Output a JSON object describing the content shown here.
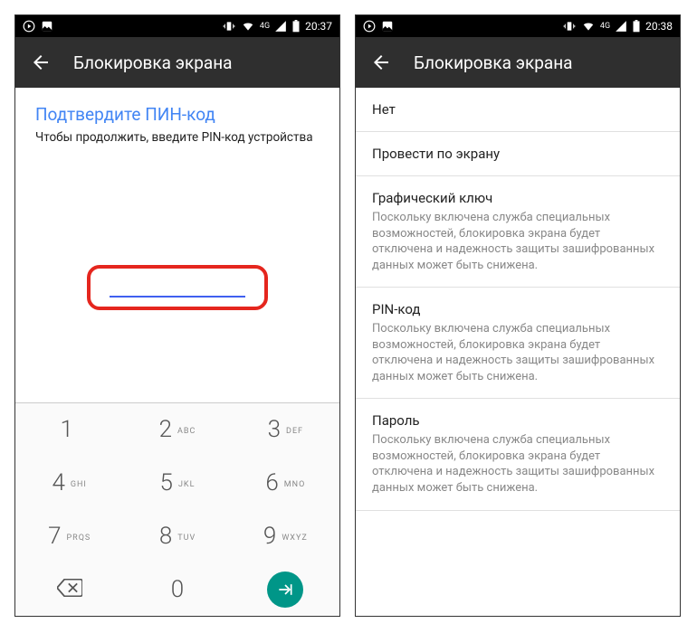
{
  "left": {
    "status": {
      "network": "4G",
      "time": "20:37"
    },
    "appbar": {
      "title": "Блокировка экрана"
    },
    "confirm": {
      "title": "Подтвердите ПИН-код",
      "subtitle": "Чтобы продолжить, введите PIN-код устройства"
    },
    "keypad": {
      "keys": [
        {
          "d": "1",
          "l": ""
        },
        {
          "d": "2",
          "l": "ABC"
        },
        {
          "d": "3",
          "l": "DEF"
        },
        {
          "d": "4",
          "l": "GHI"
        },
        {
          "d": "5",
          "l": "JKL"
        },
        {
          "d": "6",
          "l": "MNO"
        },
        {
          "d": "7",
          "l": "PRQS"
        },
        {
          "d": "8",
          "l": "TUV"
        },
        {
          "d": "9",
          "l": "WXYZ"
        },
        {
          "d": "",
          "l": ""
        },
        {
          "d": "0",
          "l": ""
        },
        {
          "d": "",
          "l": ""
        }
      ]
    }
  },
  "right": {
    "status": {
      "network": "4G",
      "time": "20:38"
    },
    "appbar": {
      "title": "Блокировка экрана"
    },
    "list": [
      {
        "title": "Нет",
        "sub": ""
      },
      {
        "title": "Провести по экрану",
        "sub": ""
      },
      {
        "title": "Графический ключ",
        "sub": "Поскольку включена служба специальных возможностей, блокировка экрана будет отключена и надежность защиты зашифрованных данных может быть снижена."
      },
      {
        "title": "PIN-код",
        "sub": "Поскольку включена служба специальных возможностей, блокировка экрана будет отключена и надежность защиты зашифрованных данных может быть снижена."
      },
      {
        "title": "Пароль",
        "sub": "Поскольку включена служба специальных возможностей, блокировка экрана будет отключена и надежность защиты зашифрованных данных может быть снижена."
      }
    ]
  }
}
